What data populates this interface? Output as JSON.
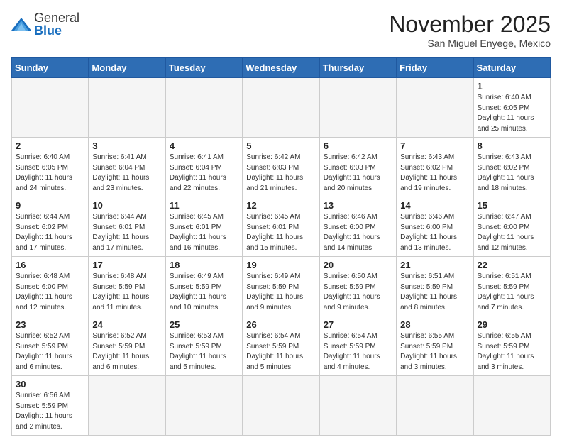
{
  "logo": {
    "general": "General",
    "blue": "Blue"
  },
  "title": "November 2025",
  "location": "San Miguel Enyege, Mexico",
  "weekdays": [
    "Sunday",
    "Monday",
    "Tuesday",
    "Wednesday",
    "Thursday",
    "Friday",
    "Saturday"
  ],
  "weeks": [
    [
      {
        "day": null
      },
      {
        "day": null
      },
      {
        "day": null
      },
      {
        "day": null
      },
      {
        "day": null
      },
      {
        "day": null
      },
      {
        "day": 1,
        "sunrise": "6:40 AM",
        "sunset": "6:05 PM",
        "daylight": "11 hours and 25 minutes."
      }
    ],
    [
      {
        "day": 2,
        "sunrise": "6:40 AM",
        "sunset": "6:05 PM",
        "daylight": "11 hours and 24 minutes."
      },
      {
        "day": 3,
        "sunrise": "6:41 AM",
        "sunset": "6:04 PM",
        "daylight": "11 hours and 23 minutes."
      },
      {
        "day": 4,
        "sunrise": "6:41 AM",
        "sunset": "6:04 PM",
        "daylight": "11 hours and 22 minutes."
      },
      {
        "day": 5,
        "sunrise": "6:42 AM",
        "sunset": "6:03 PM",
        "daylight": "11 hours and 21 minutes."
      },
      {
        "day": 6,
        "sunrise": "6:42 AM",
        "sunset": "6:03 PM",
        "daylight": "11 hours and 20 minutes."
      },
      {
        "day": 7,
        "sunrise": "6:43 AM",
        "sunset": "6:02 PM",
        "daylight": "11 hours and 19 minutes."
      },
      {
        "day": 8,
        "sunrise": "6:43 AM",
        "sunset": "6:02 PM",
        "daylight": "11 hours and 18 minutes."
      }
    ],
    [
      {
        "day": 9,
        "sunrise": "6:44 AM",
        "sunset": "6:02 PM",
        "daylight": "11 hours and 17 minutes."
      },
      {
        "day": 10,
        "sunrise": "6:44 AM",
        "sunset": "6:01 PM",
        "daylight": "11 hours and 17 minutes."
      },
      {
        "day": 11,
        "sunrise": "6:45 AM",
        "sunset": "6:01 PM",
        "daylight": "11 hours and 16 minutes."
      },
      {
        "day": 12,
        "sunrise": "6:45 AM",
        "sunset": "6:01 PM",
        "daylight": "11 hours and 15 minutes."
      },
      {
        "day": 13,
        "sunrise": "6:46 AM",
        "sunset": "6:00 PM",
        "daylight": "11 hours and 14 minutes."
      },
      {
        "day": 14,
        "sunrise": "6:46 AM",
        "sunset": "6:00 PM",
        "daylight": "11 hours and 13 minutes."
      },
      {
        "day": 15,
        "sunrise": "6:47 AM",
        "sunset": "6:00 PM",
        "daylight": "11 hours and 12 minutes."
      }
    ],
    [
      {
        "day": 16,
        "sunrise": "6:48 AM",
        "sunset": "6:00 PM",
        "daylight": "11 hours and 12 minutes."
      },
      {
        "day": 17,
        "sunrise": "6:48 AM",
        "sunset": "5:59 PM",
        "daylight": "11 hours and 11 minutes."
      },
      {
        "day": 18,
        "sunrise": "6:49 AM",
        "sunset": "5:59 PM",
        "daylight": "11 hours and 10 minutes."
      },
      {
        "day": 19,
        "sunrise": "6:49 AM",
        "sunset": "5:59 PM",
        "daylight": "11 hours and 9 minutes."
      },
      {
        "day": 20,
        "sunrise": "6:50 AM",
        "sunset": "5:59 PM",
        "daylight": "11 hours and 9 minutes."
      },
      {
        "day": 21,
        "sunrise": "6:51 AM",
        "sunset": "5:59 PM",
        "daylight": "11 hours and 8 minutes."
      },
      {
        "day": 22,
        "sunrise": "6:51 AM",
        "sunset": "5:59 PM",
        "daylight": "11 hours and 7 minutes."
      }
    ],
    [
      {
        "day": 23,
        "sunrise": "6:52 AM",
        "sunset": "5:59 PM",
        "daylight": "11 hours and 6 minutes."
      },
      {
        "day": 24,
        "sunrise": "6:52 AM",
        "sunset": "5:59 PM",
        "daylight": "11 hours and 6 minutes."
      },
      {
        "day": 25,
        "sunrise": "6:53 AM",
        "sunset": "5:59 PM",
        "daylight": "11 hours and 5 minutes."
      },
      {
        "day": 26,
        "sunrise": "6:54 AM",
        "sunset": "5:59 PM",
        "daylight": "11 hours and 5 minutes."
      },
      {
        "day": 27,
        "sunrise": "6:54 AM",
        "sunset": "5:59 PM",
        "daylight": "11 hours and 4 minutes."
      },
      {
        "day": 28,
        "sunrise": "6:55 AM",
        "sunset": "5:59 PM",
        "daylight": "11 hours and 3 minutes."
      },
      {
        "day": 29,
        "sunrise": "6:55 AM",
        "sunset": "5:59 PM",
        "daylight": "11 hours and 3 minutes."
      }
    ],
    [
      {
        "day": 30,
        "sunrise": "6:56 AM",
        "sunset": "5:59 PM",
        "daylight": "11 hours and 2 minutes."
      },
      {
        "day": null
      },
      {
        "day": null
      },
      {
        "day": null
      },
      {
        "day": null
      },
      {
        "day": null
      },
      {
        "day": null
      }
    ]
  ]
}
